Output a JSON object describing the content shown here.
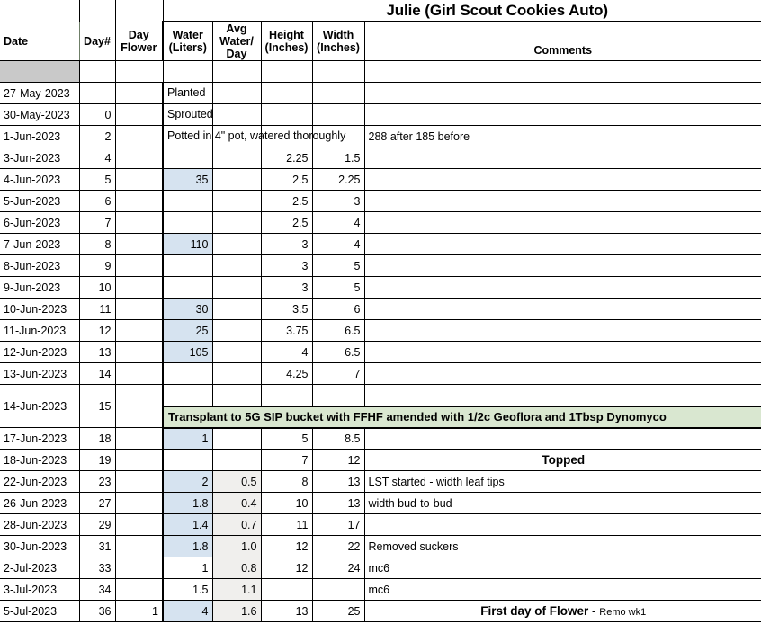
{
  "title": "Julie (Girl Scout Cookies Auto)",
  "columns": {
    "date": "Date",
    "day_num": "Day#",
    "day_flower_l1": "Day",
    "day_flower_l2": "Flower",
    "water_l1": "Water",
    "water_l2": "(Liters)",
    "avg_l1": "Avg",
    "avg_l2": "Water/",
    "avg_l3": "Day",
    "height_l1": "Height",
    "height_l2": "(Inches)",
    "width_l1": "Width",
    "width_l2": "(Inches)",
    "comments": "Comments"
  },
  "colors": {
    "header_green": "#d9e7d0",
    "water_fill": "#d6e3f0",
    "avg_fill": "#f0efed",
    "separator": "#c9c9c9",
    "grid": "#000000"
  },
  "rows": [
    {
      "date": "27-May-2023",
      "day": "",
      "flower": "",
      "water": "",
      "avg": "",
      "height": "",
      "width": "",
      "comments": "",
      "spill": "Planted"
    },
    {
      "date": "30-May-2023",
      "day": "0",
      "flower": "",
      "water": "",
      "avg": "",
      "height": "",
      "width": "",
      "comments": "",
      "spill": "Sprouted"
    },
    {
      "date": "1-Jun-2023",
      "day": "2",
      "flower": "",
      "water": "",
      "avg": "",
      "height": "",
      "width": "",
      "comments": "288 after 185 before",
      "spill": "Potted in 4\" pot, watered thoroughly"
    },
    {
      "date": "3-Jun-2023",
      "day": "4",
      "flower": "",
      "water": "",
      "avg": "",
      "height": "2.25",
      "width": "1.5",
      "comments": ""
    },
    {
      "date": "4-Jun-2023",
      "day": "5",
      "flower": "",
      "water": "35",
      "avg": "",
      "height": "2.5",
      "width": "2.25",
      "comments": ""
    },
    {
      "date": "5-Jun-2023",
      "day": "6",
      "flower": "",
      "water": "",
      "avg": "",
      "height": "2.5",
      "width": "3",
      "comments": ""
    },
    {
      "date": "6-Jun-2023",
      "day": "7",
      "flower": "",
      "water": "",
      "avg": "",
      "height": "2.5",
      "width": "4",
      "comments": ""
    },
    {
      "date": "7-Jun-2023",
      "day": "8",
      "flower": "",
      "water": "110",
      "avg": "",
      "height": "3",
      "width": "4",
      "comments": ""
    },
    {
      "date": "8-Jun-2023",
      "day": "9",
      "flower": "",
      "water": "",
      "avg": "",
      "height": "3",
      "width": "5",
      "comments": ""
    },
    {
      "date": "9-Jun-2023",
      "day": "10",
      "flower": "",
      "water": "",
      "avg": "",
      "height": "3",
      "width": "5",
      "comments": ""
    },
    {
      "date": "10-Jun-2023",
      "day": "11",
      "flower": "",
      "water": "30",
      "avg": "",
      "height": "3.5",
      "width": "6",
      "comments": ""
    },
    {
      "date": "11-Jun-2023",
      "day": "12",
      "flower": "",
      "water": "25",
      "avg": "",
      "height": "3.75",
      "width": "6.5",
      "comments": ""
    },
    {
      "date": "12-Jun-2023",
      "day": "13",
      "flower": "",
      "water": "105",
      "avg": "",
      "height": "4",
      "width": "6.5",
      "comments": ""
    },
    {
      "date": "13-Jun-2023",
      "day": "14",
      "flower": "",
      "water": "",
      "avg": "",
      "height": "4.25",
      "width": "7",
      "comments": ""
    },
    {
      "date": "14-Jun-2023",
      "day": "15",
      "flower": "",
      "water": "",
      "avg": "",
      "height": "",
      "width": "",
      "comments": ""
    },
    {
      "date": "17-Jun-2023",
      "day": "18",
      "flower": "",
      "water": "1",
      "avg": "",
      "height": "5",
      "width": "8.5",
      "comments": ""
    },
    {
      "date": "18-Jun-2023",
      "day": "19",
      "flower": "",
      "water": "",
      "avg": "",
      "height": "7",
      "width": "12",
      "comments": "Topped"
    },
    {
      "date": "22-Jun-2023",
      "day": "23",
      "flower": "",
      "water": "2",
      "avg": "0.5",
      "height": "8",
      "width": "13",
      "comments": "LST started - width leaf tips"
    },
    {
      "date": "26-Jun-2023",
      "day": "27",
      "flower": "",
      "water": "1.8",
      "avg": "0.4",
      "height": "10",
      "width": "13",
      "comments": "width bud-to-bud"
    },
    {
      "date": "28-Jun-2023",
      "day": "29",
      "flower": "",
      "water": "1.4",
      "avg": "0.7",
      "height": "11",
      "width": "17",
      "comments": ""
    },
    {
      "date": "30-Jun-2023",
      "day": "31",
      "flower": "",
      "water": "1.8",
      "avg": "1.0",
      "height": "12",
      "width": "22",
      "comments": "Removed suckers"
    },
    {
      "date": "2-Jul-2023",
      "day": "33",
      "flower": "",
      "water": "1",
      "avg": "0.8",
      "height": "12",
      "width": "24",
      "comments": "mc6"
    },
    {
      "date": "3-Jul-2023",
      "day": "34",
      "flower": "",
      "water": "1.5",
      "avg": "1.1",
      "height": "",
      "width": "",
      "comments": "mc6"
    },
    {
      "date": "5-Jul-2023",
      "day": "36",
      "flower": "1",
      "water": "4",
      "avg": "1.6",
      "height": "13",
      "width": "25",
      "comments": ""
    }
  ],
  "banners": {
    "transplant": "Transplant to 5G SIP bucket with FFHF amended with 1/2c Geoflora and 1Tbsp Dynomyco",
    "topped": "Topped",
    "first_flower_main": "First day of Flower - ",
    "first_flower_sub": "Remo wk1"
  }
}
